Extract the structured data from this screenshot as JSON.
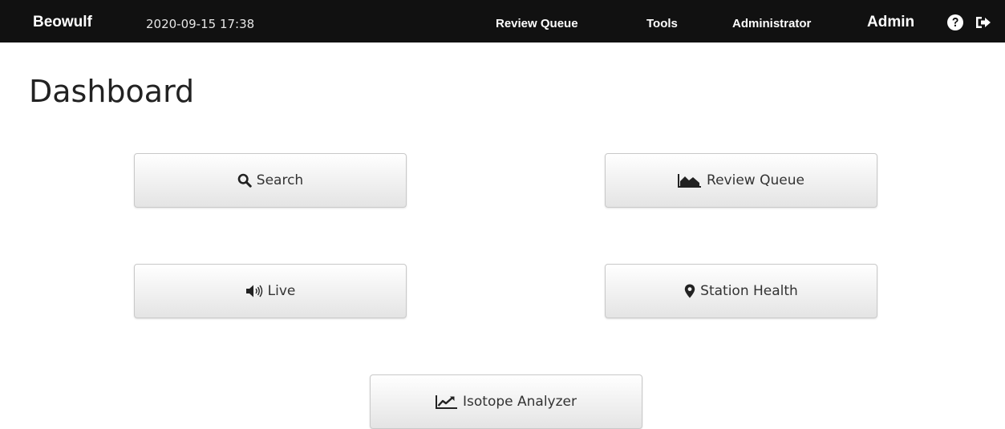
{
  "topbar": {
    "brand": "Beowulf",
    "datetime": "2020-09-15 17:38",
    "nav": {
      "review_queue": "Review Queue",
      "tools": "Tools",
      "administrator": "Administrator"
    },
    "user": "Admin",
    "icons": {
      "help": "question-circle-icon",
      "logout": "sign-out-icon"
    }
  },
  "page": {
    "title": "Dashboard"
  },
  "dashboard": {
    "search": {
      "label": "Search",
      "icon": "search-icon"
    },
    "review_queue": {
      "label": "Review Queue",
      "icon": "area-chart-icon"
    },
    "live": {
      "label": "Live",
      "icon": "volume-up-icon"
    },
    "station_health": {
      "label": "Station Health",
      "icon": "map-marker-icon"
    },
    "isotope_analyzer": {
      "label": "Isotope Analyzer",
      "icon": "line-chart-icon"
    }
  },
  "colors": {
    "topbar_bg": "#111111",
    "button_border": "#c9c9c9",
    "text": "#333333"
  }
}
